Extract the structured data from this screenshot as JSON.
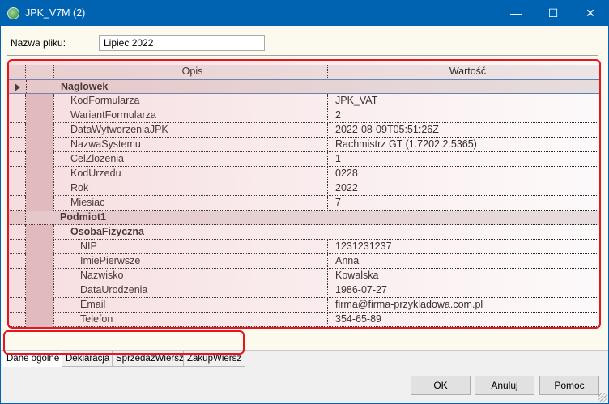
{
  "window": {
    "title": "JPK_V7M (2)",
    "minimize": "—",
    "maximize": "☐",
    "close": "✕"
  },
  "file": {
    "label": "Nazwa pliku:",
    "value": "Lipiec 2022"
  },
  "grid": {
    "columns": [
      "Opis",
      "Wartość"
    ],
    "rows": [
      {
        "name": "Naglowek",
        "value": "",
        "level": 0,
        "group": true,
        "selected": true
      },
      {
        "name": "KodFormularza",
        "value": "JPK_VAT",
        "level": 1
      },
      {
        "name": "WariantFormularza",
        "value": "2",
        "level": 1
      },
      {
        "name": "DataWytworzeniaJPK",
        "value": "2022-08-09T05:51:26Z",
        "level": 1
      },
      {
        "name": "NazwaSystemu",
        "value": "Rachmistrz GT (1.7202.2.5365)",
        "level": 1
      },
      {
        "name": "CelZlozenia",
        "value": "1",
        "level": 1
      },
      {
        "name": "KodUrzedu",
        "value": "0228",
        "level": 1
      },
      {
        "name": "Rok",
        "value": "2022",
        "level": 1
      },
      {
        "name": "Miesiac",
        "value": "7",
        "level": 1
      },
      {
        "name": "Podmiot1",
        "value": "",
        "level": 0,
        "group": true
      },
      {
        "name": "OsobaFizyczna",
        "value": "",
        "level": 1,
        "bold": true
      },
      {
        "name": "NIP",
        "value": "1231231237",
        "level": 2
      },
      {
        "name": "ImiePierwsze",
        "value": "Anna",
        "level": 2
      },
      {
        "name": "Nazwisko",
        "value": "Kowalska",
        "level": 2
      },
      {
        "name": "DataUrodzenia",
        "value": "1986-07-27",
        "level": 2
      },
      {
        "name": "Email",
        "value": "firma@firma-przykladowa.com.pl",
        "level": 2
      },
      {
        "name": "Telefon",
        "value": "354-65-89",
        "level": 2
      }
    ]
  },
  "tabs": [
    "Dane ogólne",
    "Deklaracja",
    "SprzedazWiersz",
    "ZakupWiersz"
  ],
  "buttons": {
    "ok": "OK",
    "cancel": "Anuluj",
    "help": "Pomoc"
  }
}
